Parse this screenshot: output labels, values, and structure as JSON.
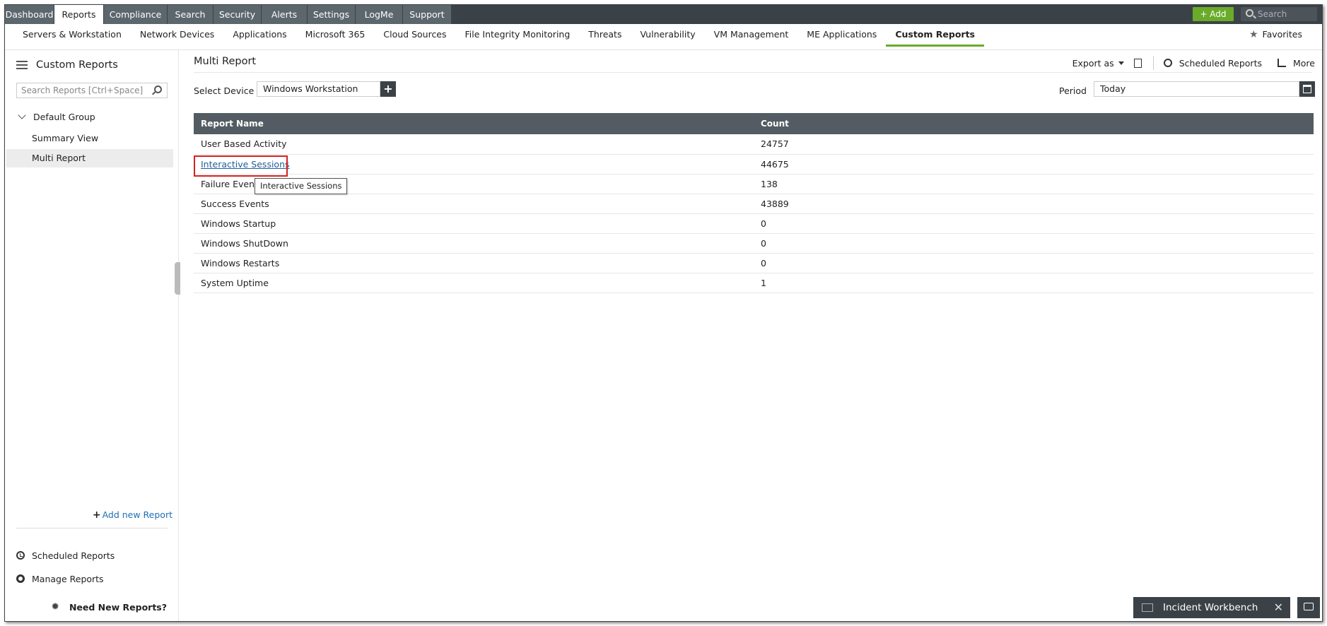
{
  "top_tabs": [
    "Dashboard",
    "Reports",
    "Compliance",
    "Search",
    "Security",
    "Alerts",
    "Settings",
    "LogMe",
    "Support"
  ],
  "top_actions": {
    "add_label": "+ Add",
    "search_placeholder": "Search"
  },
  "sub_nav": {
    "items": [
      "Servers & Workstation",
      "Network Devices",
      "Applications",
      "Microsoft 365",
      "Cloud Sources",
      "File Integrity Monitoring",
      "Threats",
      "Vulnerability",
      "VM Management",
      "ME Applications",
      "Custom Reports"
    ],
    "active": "Custom Reports",
    "favorites_label": "Favorites"
  },
  "sidebar": {
    "title": "Custom Reports",
    "search_placeholder": "Search Reports [Ctrl+Space]",
    "group": "Default Group",
    "items": [
      "Summary View",
      "Multi Report"
    ],
    "active_item": "Multi Report",
    "add_new": "Add new Report",
    "scheduled": "Scheduled Reports",
    "manage": "Manage Reports",
    "need_new": "Need New Reports?"
  },
  "main": {
    "title": "Multi Report",
    "toolbar": {
      "export_label": "Export as",
      "scheduled_label": "Scheduled Reports",
      "more_label": "More"
    },
    "device_label": "Select Device",
    "device_value": "Windows Workstation",
    "period_label": "Period",
    "period_value": "Today",
    "table": {
      "headers": [
        "Report Name",
        "Count"
      ],
      "rows": [
        {
          "name": "User Based Activity",
          "count": "24757"
        },
        {
          "name": "Interactive Sessions",
          "count": "44675"
        },
        {
          "name": "Failure Events",
          "count": "138"
        },
        {
          "name": "Success Events",
          "count": "43889"
        },
        {
          "name": "Windows Startup",
          "count": "0"
        },
        {
          "name": "Windows ShutDown",
          "count": "0"
        },
        {
          "name": "Windows Restarts",
          "count": "0"
        },
        {
          "name": "System Uptime",
          "count": "1"
        }
      ]
    },
    "tooltip": "Interactive Sessions"
  },
  "footer": {
    "incident_workbench": "Incident Workbench"
  },
  "colors": {
    "accent_green": "#6aab2a",
    "header_dark": "#3b4247",
    "link_blue": "#1f5e9c",
    "highlight_red": "#d62020"
  }
}
